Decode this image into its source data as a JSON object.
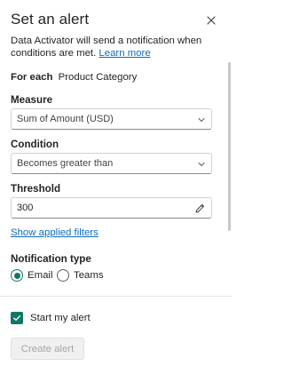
{
  "header": {
    "title": "Set an alert",
    "close_icon": "close-icon"
  },
  "description": {
    "text": "Data Activator will send a notification when conditions are met.",
    "link": "Learn more"
  },
  "for_each": {
    "label": "For each",
    "value": "Product Category"
  },
  "measure": {
    "label": "Measure",
    "value": "Sum of Amount (USD)",
    "icon": "chevron-down-icon"
  },
  "condition": {
    "label": "Condition",
    "value": "Becomes greater than",
    "icon": "chevron-down-icon"
  },
  "threshold": {
    "label": "Threshold",
    "value": "300",
    "icon": "pencil-icon"
  },
  "filters_link": "Show applied filters",
  "notification": {
    "label": "Notification type",
    "options": [
      {
        "label": "Email",
        "selected": true
      },
      {
        "label": "Teams",
        "selected": false
      }
    ]
  },
  "start_alert": {
    "label": "Start my alert",
    "checked": true
  },
  "create_button": {
    "label": "Create alert",
    "disabled": true
  },
  "colors": {
    "accent": "#117865",
    "link": "#0f6cbd"
  }
}
